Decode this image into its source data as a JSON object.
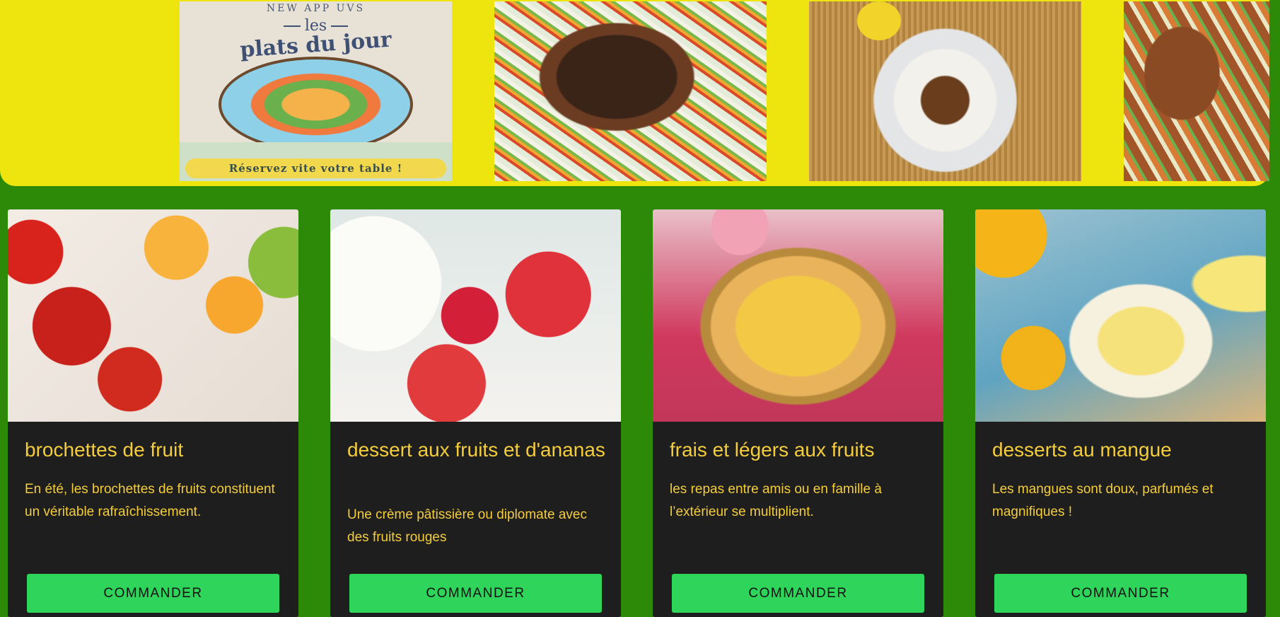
{
  "banner": {
    "poster": {
      "app_label": "NEW APP UVS",
      "les": "les",
      "title": "plats du jour",
      "cta": "Réservez vite votre table !"
    }
  },
  "cards": [
    {
      "title": "brochettes de fruit",
      "description": "En été, les brochettes de fruits constituent un véritable rafraîchissement.",
      "button": "COMMANDER"
    },
    {
      "title": "dessert aux fruits et d'ananas",
      "description": "Une crème pâtissière ou diplomate avec des fruits rouges",
      "button": "COMMANDER"
    },
    {
      "title": "frais et légers aux fruits",
      "description": "les repas entre amis ou en famille à l’extérieur se multiplient.",
      "button": "COMMANDER"
    },
    {
      "title": "desserts au mangue",
      "description": "Les mangues sont doux, parfumés et magnifiques !",
      "button": "COMMANDER"
    }
  ],
  "colors": {
    "page_background": "#2d8a08",
    "banner_background": "#ede50d",
    "card_background": "#1e1e1e",
    "card_text": "#f4cd3c",
    "button": "#2fd45a"
  }
}
